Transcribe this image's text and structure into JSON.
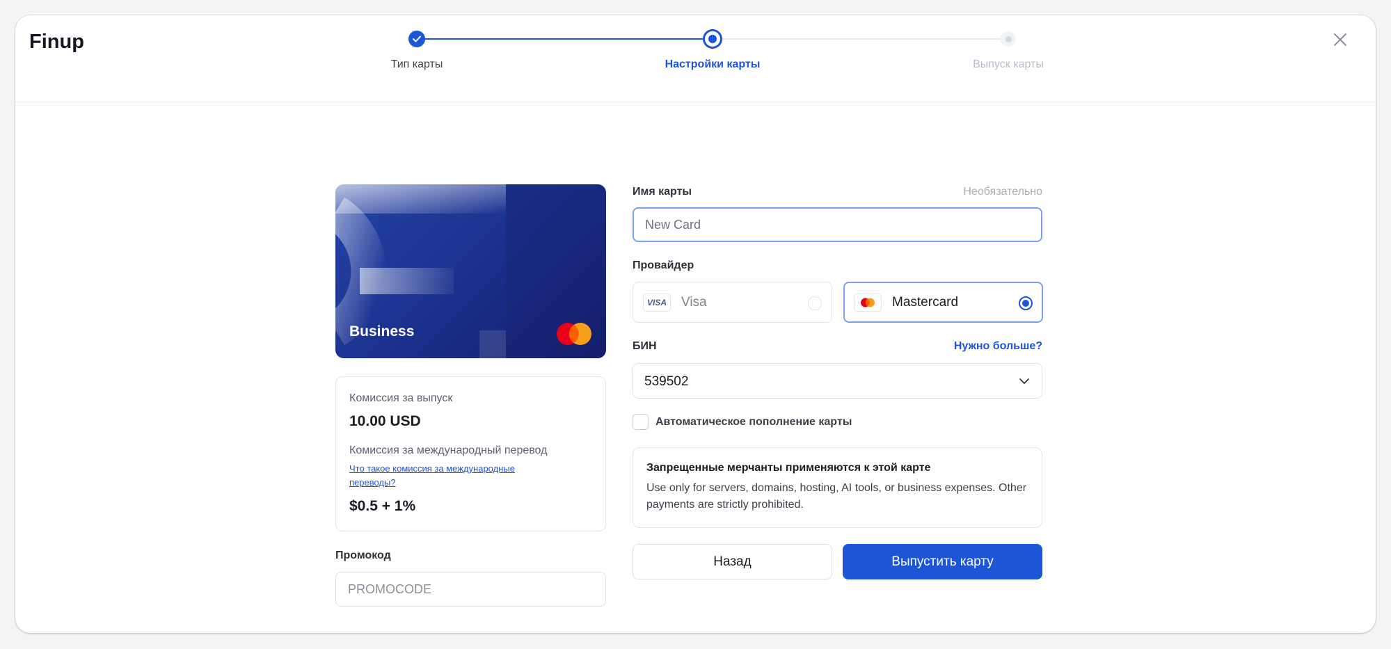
{
  "brand": {
    "logo_text": "Finup"
  },
  "stepper": {
    "steps": [
      {
        "label": "Тип карты",
        "state": "done"
      },
      {
        "label": "Настройки карты",
        "state": "active"
      },
      {
        "label": "Выпуск карты",
        "state": "pending"
      }
    ]
  },
  "card_preview": {
    "name": "Business",
    "network_icon": "mastercard-logo"
  },
  "fees": {
    "issue_label": "Комиссия за выпуск",
    "issue_value": "10.00 USD",
    "intl_label": "Комиссия за международный перевод",
    "intl_link": "Что такое комиссия за международные переводы?",
    "intl_value": "$0.5 + 1%"
  },
  "promo": {
    "label": "Промокод",
    "placeholder": "PROMOCODE",
    "value": ""
  },
  "form": {
    "card_name_label": "Имя карты",
    "card_name_optional": "Необязательно",
    "card_name_placeholder": "New Card",
    "card_name_value": "",
    "provider_label": "Провайдер",
    "providers": [
      {
        "name": "Visa",
        "icon_text": "VISA",
        "selected": false
      },
      {
        "name": "Mastercard",
        "selected": true
      }
    ],
    "bin_label": "БИН",
    "bin_more_link": "Нужно больше?",
    "bin_value": "539502",
    "auto_topup_label": "Автоматическое пополнение карты",
    "auto_topup_checked": false
  },
  "notice": {
    "title": "Запрещенные мерчанты применяются к этой карте",
    "text": "Use only for servers, domains, hosting, AI tools, or business expenses. Other payments are strictly prohibited."
  },
  "actions": {
    "back_label": "Назад",
    "issue_label": "Выпустить карту"
  },
  "colors": {
    "accent": "#1c55d8",
    "card_bg": "#1a2f8a",
    "mastercard_red": "#eb001b",
    "mastercard_orange": "#f79e1b"
  }
}
